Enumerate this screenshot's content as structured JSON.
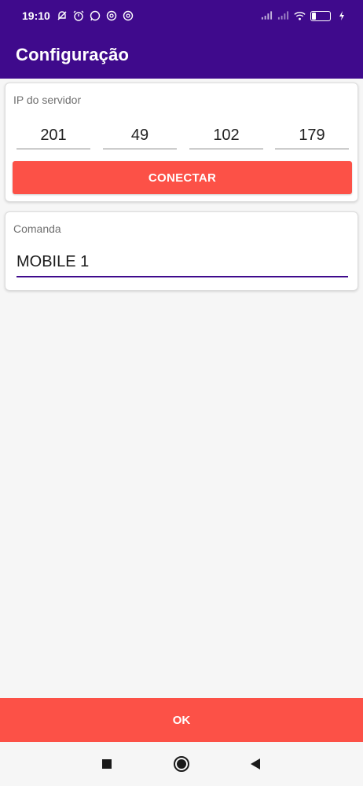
{
  "status_bar": {
    "time": "19:10",
    "battery": "22",
    "icons_left": [
      "bell-off-icon",
      "alarm-icon",
      "whatsapp-icon",
      "at-sign-icon",
      "at-sign-icon"
    ],
    "icons_right": [
      "signal-icon",
      "signal-icon",
      "wifi-icon",
      "battery-icon",
      "charging-icon"
    ]
  },
  "app_bar": {
    "title": "Configuração"
  },
  "ip_card": {
    "label": "IP do servidor",
    "octets": [
      "201",
      "49",
      "102",
      "179"
    ],
    "connect_label": "CONECTAR"
  },
  "comanda_card": {
    "label": "Comanda",
    "value": "MOBILE 1"
  },
  "ok_label": "OK",
  "nav_bar": {
    "icons": [
      "recents-square-icon",
      "home-circle-icon",
      "back-triangle-icon"
    ]
  },
  "colors": {
    "primary": "#3f0a8c",
    "accent": "#fc5147",
    "background": "#f6f6f6"
  },
  "battery_level": 0.22
}
